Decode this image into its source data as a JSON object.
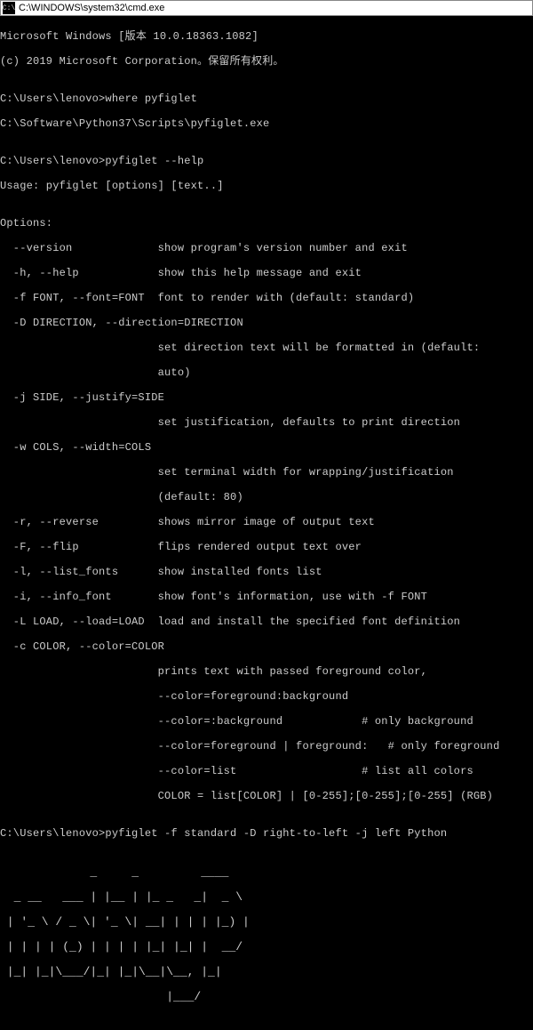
{
  "titlebar": {
    "icon_text": "C:\\",
    "title": "C:\\WINDOWS\\system32\\cmd.exe"
  },
  "lines": {
    "l0": "Microsoft Windows [版本 10.0.18363.1082]",
    "l1": "(c) 2019 Microsoft Corporation。保留所有权利。",
    "l2": "",
    "l3": "C:\\Users\\lenovo>where pyfiglet",
    "l4": "C:\\Software\\Python37\\Scripts\\pyfiglet.exe",
    "l5": "",
    "l6": "C:\\Users\\lenovo>pyfiglet --help",
    "l7": "Usage: pyfiglet [options] [text..]",
    "l8": "",
    "l9": "Options:",
    "l10": "  --version             show program's version number and exit",
    "l11": "  -h, --help            show this help message and exit",
    "l12": "  -f FONT, --font=FONT  font to render with (default: standard)",
    "l13": "  -D DIRECTION, --direction=DIRECTION",
    "l14": "                        set direction text will be formatted in (default:",
    "l15": "                        auto)",
    "l16": "  -j SIDE, --justify=SIDE",
    "l17": "                        set justification, defaults to print direction",
    "l18": "  -w COLS, --width=COLS",
    "l19": "                        set terminal width for wrapping/justification",
    "l20": "                        (default: 80)",
    "l21": "  -r, --reverse         shows mirror image of output text",
    "l22": "  -F, --flip            flips rendered output text over",
    "l23": "  -l, --list_fonts      show installed fonts list",
    "l24": "  -i, --info_font       show font's information, use with -f FONT",
    "l25": "  -L LOAD, --load=LOAD  load and install the specified font definition",
    "l26": "  -c COLOR, --color=COLOR",
    "l27": "                        prints text with passed foreground color,",
    "l28": "                        --color=foreground:background",
    "l29": "                        --color=:background            # only background",
    "l30": "                        --color=foreground | foreground:   # only foreground",
    "l31": "                        --color=list                   # list all colors",
    "l32": "                        COLOR = list[COLOR] | [0-255];[0-255];[0-255] (RGB)",
    "l33": "",
    "l34": "C:\\Users\\lenovo>pyfiglet -f standard -D right-to-left -j left Python",
    "a0": "             _     _         ____  ",
    "a1": "  _ __   ___ | |__ | |_ _   _|  _ \\ ",
    "a2": " | '_ \\ / _ \\| '_ \\| __| | | | |_) |",
    "a3": " | | | | (_) | | | | |_| |_| |  __/ ",
    "a4": " |_| |_|\\___/|_| |_|\\__|\\__, |_|   ",
    "a5": "                        |___/      "
  }
}
